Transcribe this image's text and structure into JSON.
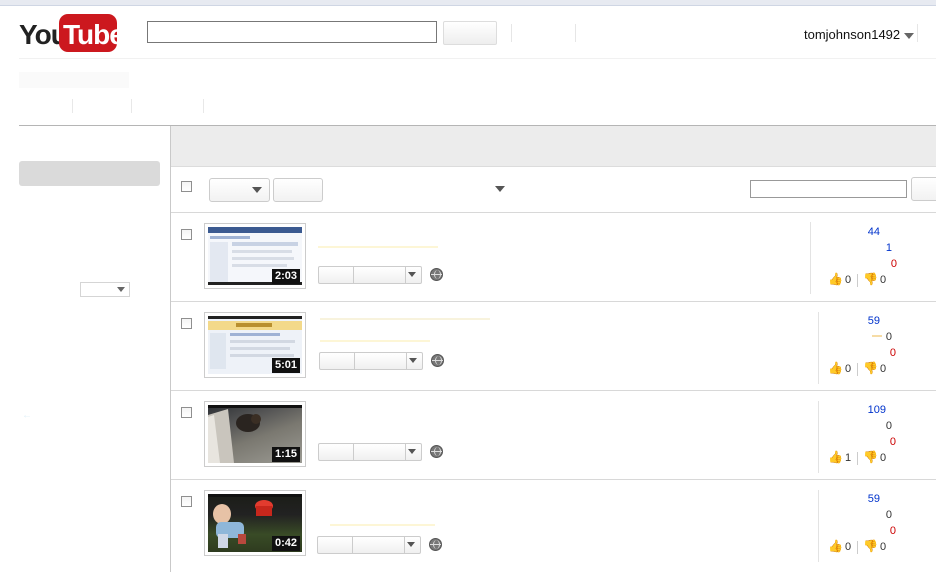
{
  "header": {
    "logo": {
      "you": "You",
      "tube": "Tube"
    },
    "username": "tomjohnson1492",
    "colors": {
      "logo_red": "#cc181e",
      "link_blue": "#0033cc",
      "dislike_red": "#cc0000"
    }
  },
  "videos": [
    {
      "duration": "2:03",
      "views": "44",
      "stat_a": "1",
      "stat_b": "0",
      "likes": "0",
      "dislikes": "0"
    },
    {
      "duration": "5:01",
      "views": "59",
      "stat_a": "0",
      "stat_b": "0",
      "likes": "0",
      "dislikes": "0"
    },
    {
      "duration": "1:15",
      "views": "109",
      "stat_a": "0",
      "stat_b": "0",
      "likes": "1",
      "dislikes": "0"
    },
    {
      "duration": "0:42",
      "views": "59",
      "stat_a": "0",
      "stat_b": "0",
      "likes": "0",
      "dislikes": "0"
    }
  ],
  "icons": [
    "caret-down-icon",
    "globe-icon",
    "thumbs-up-icon",
    "thumbs-down-icon"
  ]
}
